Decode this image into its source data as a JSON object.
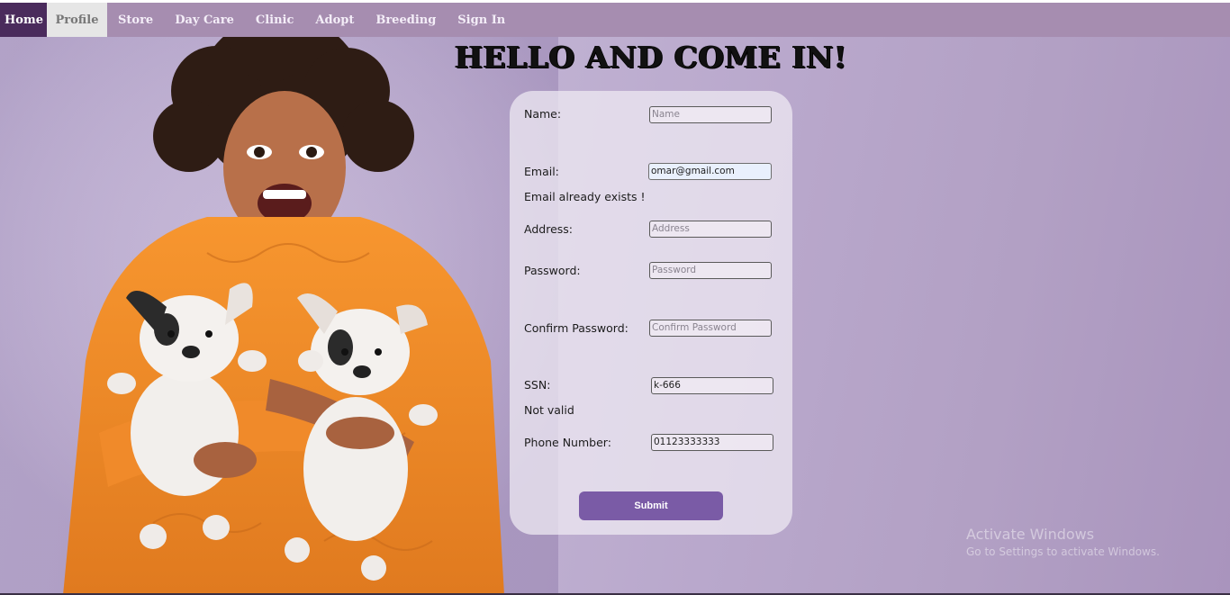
{
  "nav": {
    "items": [
      {
        "label": "Home"
      },
      {
        "label": "Profile"
      },
      {
        "label": "Store"
      },
      {
        "label": "Day Care"
      },
      {
        "label": "Clinic"
      },
      {
        "label": "Adopt"
      },
      {
        "label": "Breeding"
      },
      {
        "label": "Sign In"
      }
    ]
  },
  "headline": "HELLO AND COME IN!",
  "form": {
    "name": {
      "label": "Name:",
      "value": "",
      "placeholder": "Name"
    },
    "email": {
      "label": "Email:",
      "value": "omar@gmail.com",
      "placeholder": "",
      "error": "Email already exists !"
    },
    "address": {
      "label": "Address:",
      "value": "",
      "placeholder": "Address"
    },
    "password": {
      "label": "Password:",
      "value": "",
      "placeholder": "Password"
    },
    "confirm_password": {
      "label": "Confirm Password:",
      "value": "",
      "placeholder": "Confirm Password"
    },
    "ssn": {
      "label": "SSN:",
      "value": "k-666",
      "placeholder": "",
      "error": "Not valid"
    },
    "phone": {
      "label": "Phone Number:",
      "value": "01123333333",
      "placeholder": ""
    },
    "submit_label": "Submit"
  },
  "watermark": {
    "title": "Activate Windows",
    "subtitle": "Go to Settings to activate Windows."
  },
  "colors": {
    "nav_bg": "#a68db0",
    "nav_home_bg": "#4a2b5c",
    "submit_bg": "#7a5ba6",
    "sweater": "#f08a2a"
  }
}
